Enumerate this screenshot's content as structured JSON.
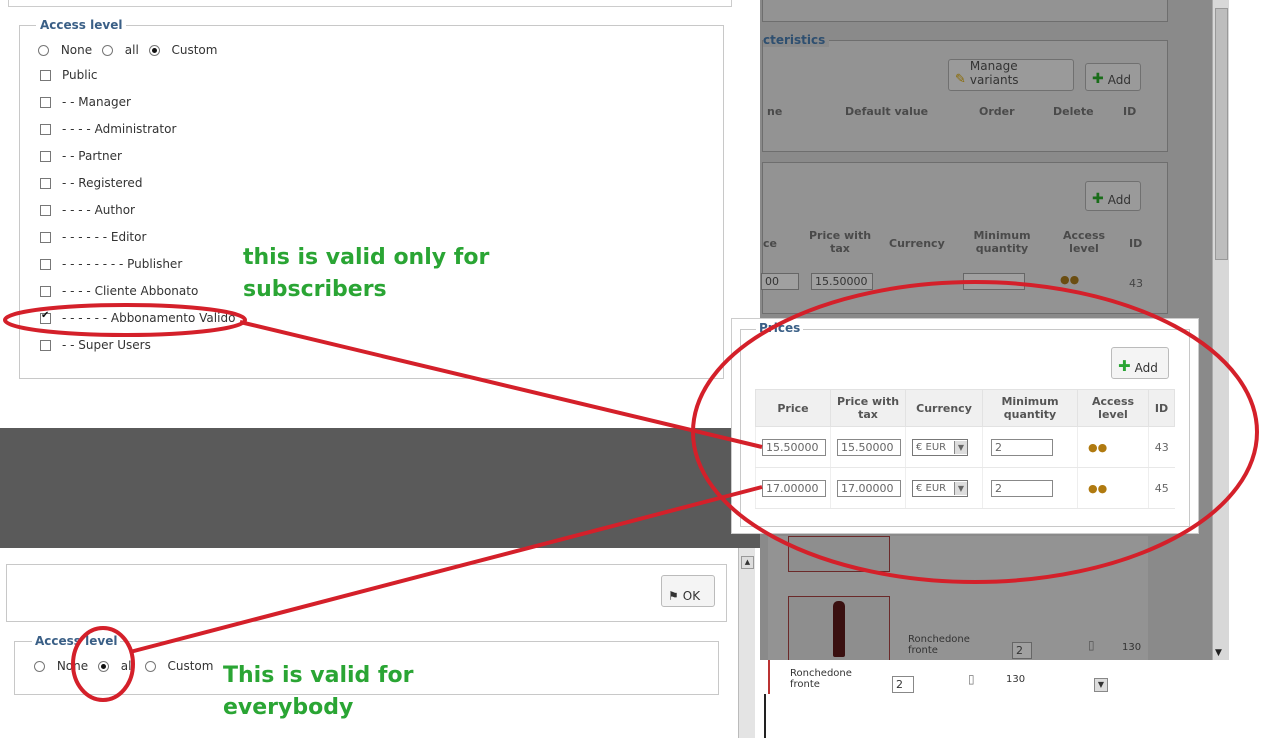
{
  "colors": {
    "annotation_green": "#2aa534",
    "annotation_red": "#d4202a",
    "legend_blue": "#3a5f86"
  },
  "background": {
    "characteristics_legend": "cteristics",
    "manage_variants_label": "Manage variants",
    "add_label_1": "Add",
    "add_label_2": "Add",
    "char_headers": [
      "ne",
      "Default value",
      "Order",
      "Delete",
      "ID"
    ],
    "price_headers": [
      "ce",
      "Price with tax",
      "Currency",
      "Minimum quantity",
      "Access level",
      "ID"
    ],
    "row_value_partial": "00",
    "row_price_tax": "15.50000",
    "row_id": "43",
    "product_name": "Ronchedone fronte",
    "product_qty": "2",
    "product_id": "130",
    "product_name_2": "Ronchedone fronte",
    "product_qty_2": "2",
    "product_id_2": "130"
  },
  "access_dialog": {
    "legend": "Access level",
    "radios": [
      {
        "label": "None",
        "checked": false
      },
      {
        "label": "all",
        "checked": false
      },
      {
        "label": "Custom",
        "checked": true
      }
    ],
    "groups": [
      {
        "label": "Public",
        "checked": false
      },
      {
        "label": "- - Manager",
        "checked": false
      },
      {
        "label": "- - - - Administrator",
        "checked": false
      },
      {
        "label": "- - Partner",
        "checked": false
      },
      {
        "label": "- - Registered",
        "checked": false
      },
      {
        "label": "- - - - Author",
        "checked": false
      },
      {
        "label": "- - - - - - Editor",
        "checked": false
      },
      {
        "label": "- - - - - - - - Publisher",
        "checked": false
      },
      {
        "label": "- - - - Cliente Abbonato",
        "checked": false
      },
      {
        "label": "- - - - - - Abbonamento Valido",
        "checked": true
      },
      {
        "label": "- - Super Users",
        "checked": false
      }
    ]
  },
  "prices_dialog": {
    "legend": "Prices",
    "add_label": "Add",
    "headers": [
      "Price",
      "Price with tax",
      "Currency",
      "Minimum quantity",
      "Access level",
      "ID"
    ],
    "rows": [
      {
        "price": "15.50000",
        "price_tax": "15.50000",
        "currency": "€ EUR",
        "min_qty": "2",
        "id": "43"
      },
      {
        "price": "17.00000",
        "price_tax": "17.00000",
        "currency": "€ EUR",
        "min_qty": "2",
        "id": "45"
      }
    ]
  },
  "bottom_dialog": {
    "ok_label": "OK",
    "legend": "Access level",
    "radios": [
      {
        "label": "None",
        "checked": false
      },
      {
        "label": "all",
        "checked": true
      },
      {
        "label": "Custom",
        "checked": false
      }
    ]
  },
  "annotations": {
    "subscribers_line1": "this is valid only for",
    "subscribers_line2": "subscribers",
    "everybody_line1": "This is valid for",
    "everybody_line2": "everybody"
  }
}
